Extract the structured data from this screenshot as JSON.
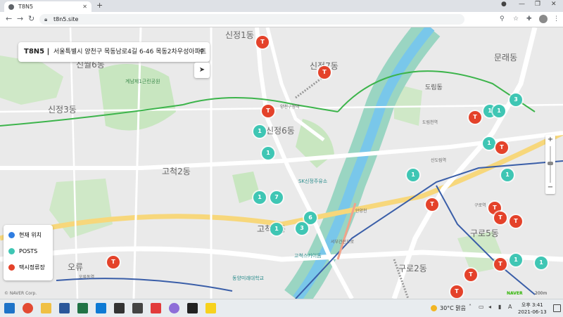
{
  "browser": {
    "tab_title": "T8N5",
    "tab_close": "✕",
    "new_tab": "+",
    "url": "t8n5.site",
    "win_minimize": "—",
    "win_maximize": "❐",
    "win_close": "✕",
    "back": "←",
    "forward": "→",
    "reload": "↻"
  },
  "map": {
    "search": {
      "brand": "T8N5 |",
      "address": "서울특별시 양천구 목동남로4길 6-46 목동2차우성아파트"
    },
    "legend": {
      "current": {
        "label": "현재 위치",
        "color": "#2f7de1"
      },
      "posts": {
        "label": "POSTS",
        "color": "#3fc6b4"
      },
      "taxi": {
        "label": "택시정류장",
        "color": "#e4422a"
      }
    },
    "district_labels": [
      "신정1동",
      "신월6동",
      "신정3동",
      "신정7동",
      "신정6동",
      "고척2동",
      "고척1동",
      "오류",
      "구로5동",
      "구로2동",
      "문래동",
      "도림동"
    ],
    "place_labels": [
      "계남제1근린공원",
      "양천구청역",
      "구로디지털",
      "도림천역",
      "신도림역",
      "구로역",
      "개봉역",
      "SK신정주유소",
      "고척스카이돔",
      "동양미래대학교",
      "안양천",
      "서부간선도로",
      "오류동역",
      "신정네거리역"
    ],
    "posts_markers": [
      "1",
      "1",
      "1",
      "1",
      "7",
      "6",
      "3",
      "1",
      "1",
      "1",
      "1",
      "1",
      "3",
      "1",
      "1"
    ],
    "taxi_marker_label": "T",
    "copyright": "© NAVER Corp.",
    "naver_logo": "NAVER",
    "scale": "200m"
  },
  "taskbar": {
    "weather": "30°C 맑음",
    "time": "오후 3:41",
    "date": "2021-06-13"
  }
}
